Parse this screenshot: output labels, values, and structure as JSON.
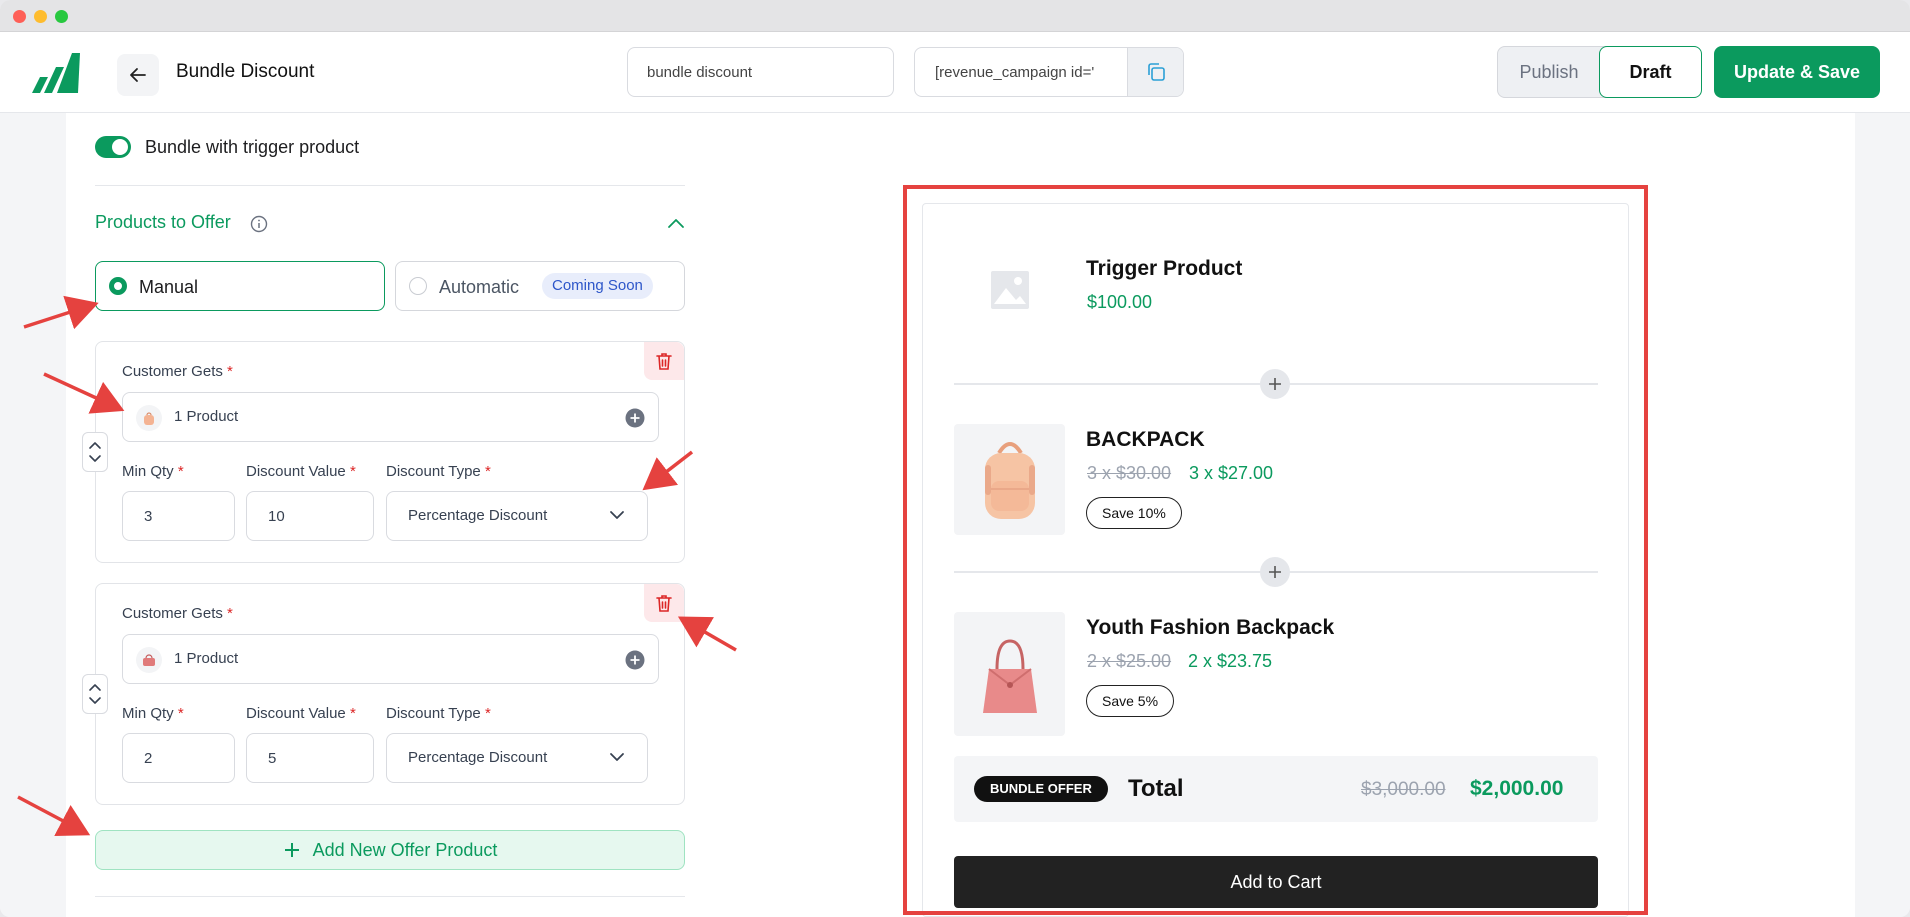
{
  "header": {
    "title": "Bundle Discount",
    "campaign_name_value": "bundle discount",
    "shortcode_value": "[revenue_campaign id='",
    "publish_label": "Publish",
    "draft_label": "Draft",
    "save_label": "Update & Save"
  },
  "settings": {
    "toggle_label": "Bundle with trigger product",
    "toggle_on": true,
    "section_title": "Products to Offer",
    "radio_manual": "Manual",
    "radio_automatic": "Automatic",
    "coming_soon": "Coming Soon",
    "offers": [
      {
        "customer_gets_label": "Customer Gets",
        "product_count": "1 Product",
        "min_qty_label": "Min Qty",
        "min_qty_value": "3",
        "discount_value_label": "Discount Value",
        "discount_value": "10",
        "discount_type_label": "Discount Type",
        "discount_type_value": "Percentage Discount"
      },
      {
        "customer_gets_label": "Customer Gets",
        "product_count": "1 Product",
        "min_qty_label": "Min Qty",
        "min_qty_value": "2",
        "discount_value_label": "Discount Value",
        "discount_value": "5",
        "discount_type_label": "Discount Type",
        "discount_type_value": "Percentage Discount"
      }
    ],
    "add_offer_label": "Add New Offer Product",
    "required_mark": "*"
  },
  "preview": {
    "trigger": {
      "name": "Trigger Product",
      "price": "$100.00"
    },
    "items": [
      {
        "name": "BACKPACK",
        "old_price": "3 x $30.00",
        "new_price": "3 x $27.00",
        "save": "Save 10%"
      },
      {
        "name": "Youth Fashion Backpack",
        "old_price": "2 x $25.00",
        "new_price": "2 x $23.75",
        "save": "Save 5%"
      }
    ],
    "bundle_badge": "BUNDLE OFFER",
    "total_label": "Total",
    "total_old": "$3,000.00",
    "total_new": "$2,000.00",
    "cart_label": "Add to Cart"
  },
  "colors": {
    "accent": "#0b9a5e",
    "danger": "#dc2626",
    "highlight": "#e5423f"
  }
}
